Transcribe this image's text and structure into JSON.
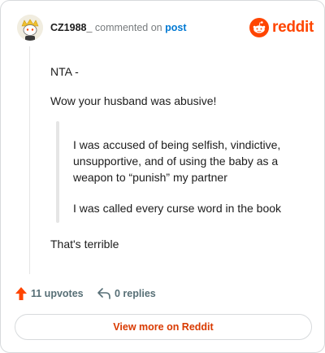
{
  "header": {
    "username": "CZ1988_",
    "action_text": "commented on",
    "post_link": "post",
    "brand_wordmark": "reddit",
    "avatar_icon": "snoo-avatar-icon",
    "brand_icon": "reddit-alien-icon"
  },
  "comment": {
    "paragraphs": [
      "NTA -",
      "Wow your husband was abusive!"
    ],
    "quote": [
      "I was accused of being selfish, vindictive, unsupportive, and of using the baby as a weapon to “punish” my partner",
      "I was called every curse word in the book"
    ],
    "closing": "That's terrible"
  },
  "footer": {
    "upvotes": "11 upvotes",
    "replies": "0 replies",
    "upvote_icon": "upvote-arrow-icon",
    "reply_icon": "reply-arrow-icon",
    "view_more": "View more on Reddit"
  },
  "colors": {
    "brand": "#ff4500",
    "link": "#0079d3",
    "cta": "#d93a00",
    "muted": "#576f76"
  }
}
